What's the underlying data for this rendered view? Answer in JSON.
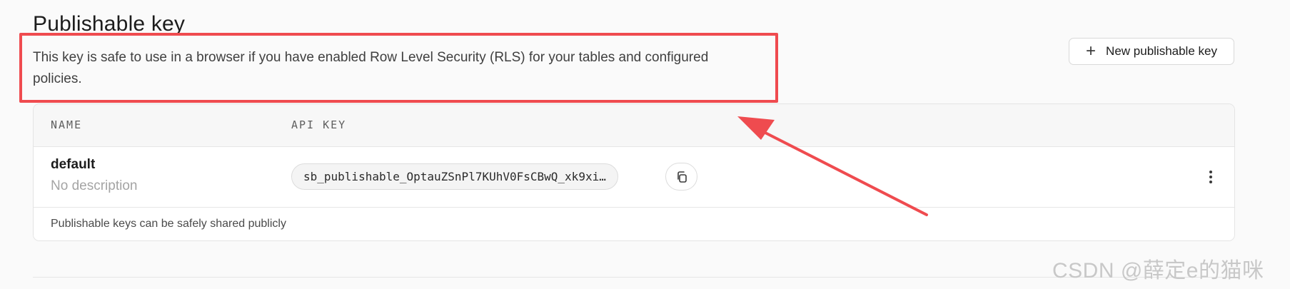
{
  "header": {
    "title": "Publishable key",
    "description": "This key is safe to use in a browser if you have enabled Row Level Security (RLS) for your tables and configured policies.",
    "new_key_button": "New publishable key",
    "new_key_icon": "plus-icon"
  },
  "table": {
    "columns": [
      "NAME",
      "API KEY"
    ],
    "rows": [
      {
        "name": "default",
        "description": "No description",
        "api_key": "sb_publishable_OptauZSnPl7KUhV0FsCBwQ_xk9xi…",
        "copy_icon": "copy-icon",
        "actions_icon": "more-vertical-icon"
      }
    ],
    "footer": "Publishable keys can be safely shared publicly"
  },
  "annotation": {
    "color": "#ef4b4f"
  },
  "watermark": "CSDN @薛定e的猫咪"
}
